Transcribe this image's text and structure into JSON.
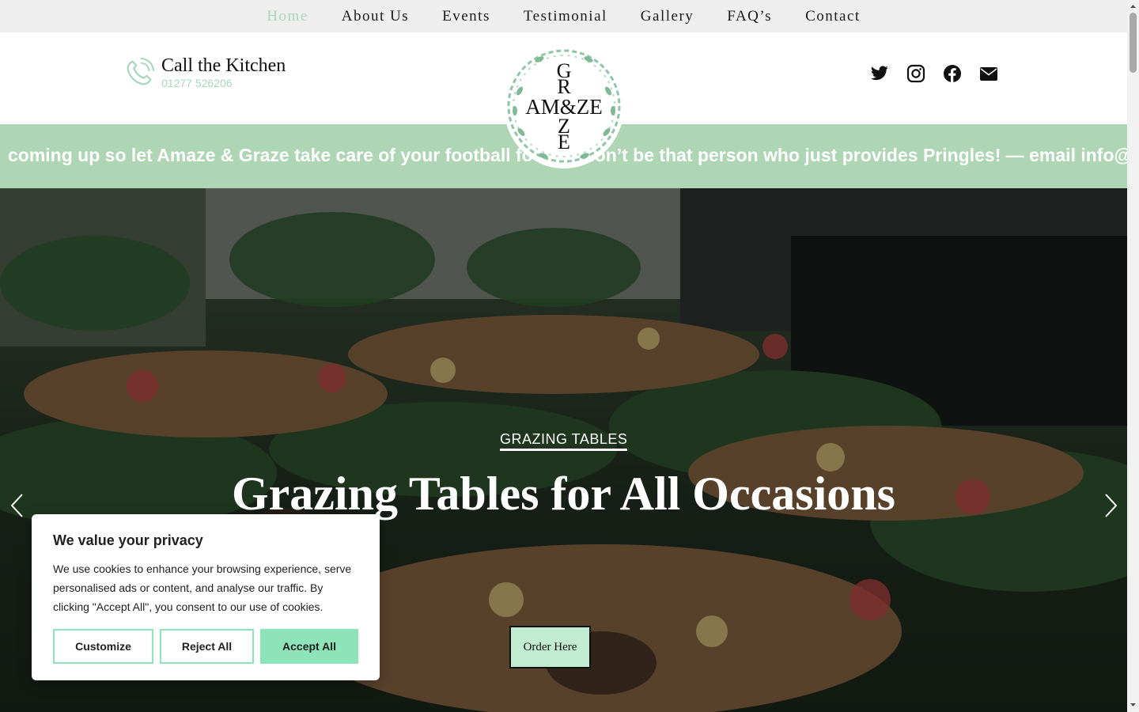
{
  "nav": {
    "items": [
      {
        "label": "Home",
        "active": true
      },
      {
        "label": "About Us"
      },
      {
        "label": "Events"
      },
      {
        "label": "Testimonial"
      },
      {
        "label": "Gallery"
      },
      {
        "label": "FAQ’s"
      },
      {
        "label": "Contact"
      }
    ]
  },
  "header": {
    "call_title": "Call the Kitchen",
    "call_number": "01277 526206",
    "socials": [
      "twitter-icon",
      "instagram-icon",
      "facebook-icon",
      "envelope-icon"
    ]
  },
  "logo": {
    "letters_top": "G",
    "letters_row2": "R",
    "letters_middle": "AM&ZE",
    "letters_row4": "Z",
    "letters_bottom": "E"
  },
  "ticker": {
    "text": "coming up so let Amaze & Graze take care of your football food — don’t be that person who just provides Pringles! — email info@amaze"
  },
  "hero": {
    "kicker": "GRAZING TABLES",
    "title": "Grazing Tables for All Occasions",
    "button": "Order Here"
  },
  "cookie": {
    "title": "We value your privacy",
    "text": "We use cookies to enhance your browsing experience, serve personalised ads or content, and analyse our traffic. By clicking \"Accept All\", you consent to our use of cookies.",
    "customize": "Customize",
    "reject": "Reject All",
    "accept": "Accept All"
  },
  "colors": {
    "accent": "#a8d8b9",
    "ticker_bg": "#afd6b4",
    "accept_bg": "#8ee4b9",
    "order_bg": "#c2ecd2"
  }
}
